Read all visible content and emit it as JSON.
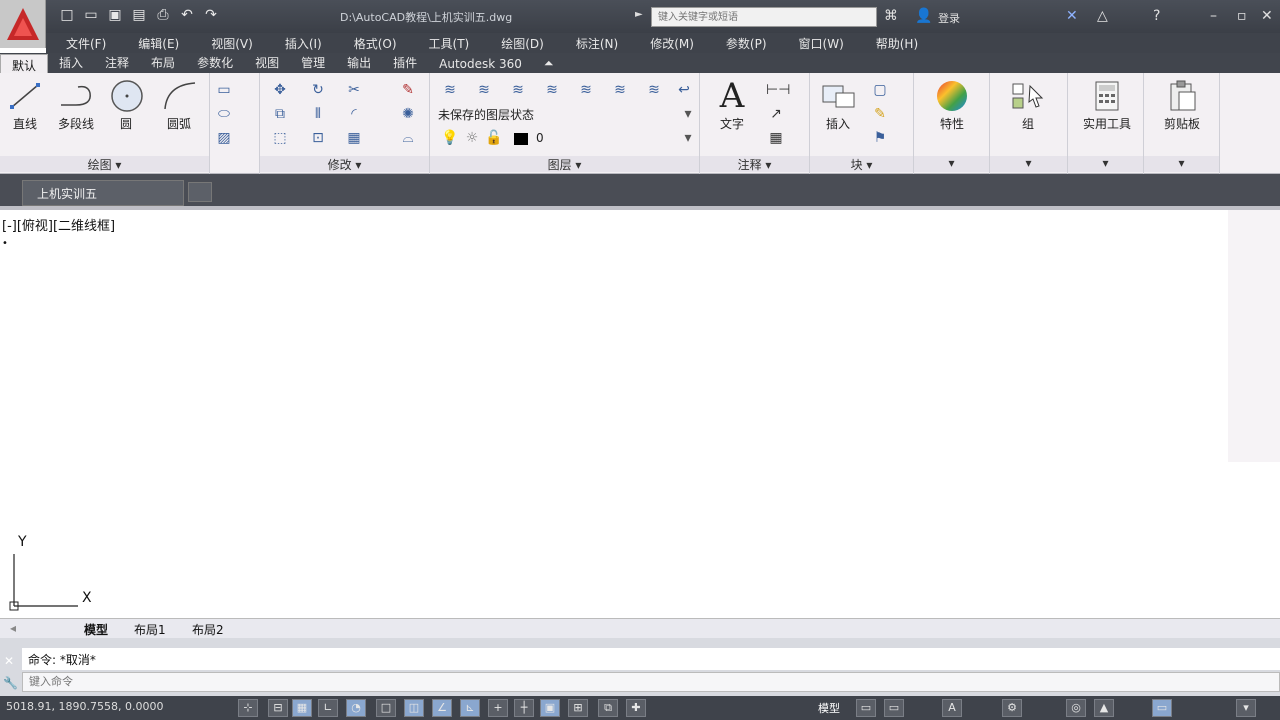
{
  "title": {
    "file": "D:\\AutoCAD教程\\上机实训五.dwg",
    "search_placeholder": "键入关键字或短语",
    "user": "登录"
  },
  "menubar": [
    "文件(F)",
    "编辑(E)",
    "视图(V)",
    "插入(I)",
    "格式(O)",
    "工具(T)",
    "绘图(D)",
    "标注(N)",
    "修改(M)",
    "参数(P)",
    "窗口(W)",
    "帮助(H)"
  ],
  "ribbon_tabs": [
    "默认",
    "插入",
    "注释",
    "布局",
    "参数化",
    "视图",
    "管理",
    "输出",
    "插件",
    "Autodesk 360"
  ],
  "panels": {
    "draw": {
      "title": "绘图",
      "line": "直线",
      "polyline": "多段线",
      "circle": "圆",
      "arc": "圆弧"
    },
    "modify": {
      "title": "修改"
    },
    "layers": {
      "title": "图层",
      "state": "未保存的图层状态",
      "current": "0"
    },
    "annotation": {
      "title": "注释",
      "text": "文字"
    },
    "block": {
      "title": "块",
      "insert": "插入"
    },
    "properties": {
      "label": "特性"
    },
    "groups": {
      "label": "组"
    },
    "utilities": {
      "label": "实用工具"
    },
    "clipboard": {
      "label": "剪贴板"
    }
  },
  "doc_tab": "上机实训五",
  "viewport_label": "[-][俯视][二维线框]",
  "ucs": {
    "y": "Y",
    "x": "X"
  },
  "layout_tabs": [
    "模型",
    "布局1",
    "布局2"
  ],
  "command": {
    "history": "命令: *取消*",
    "input": "键入命令"
  },
  "status": {
    "coords": "5018.91, 1890.7558, 0.0000",
    "model": "模型"
  }
}
